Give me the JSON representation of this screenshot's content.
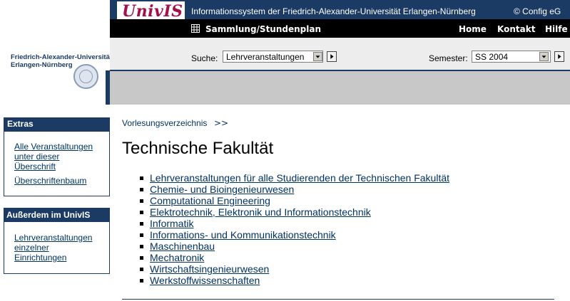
{
  "header": {
    "logo_text": "UnivIS",
    "title": "Informationssystem der Friedrich-Alexander-Universität Erlangen-Nürnberg",
    "copyright": "© Config eG",
    "university_line1": "Friedrich-Alexander-Universität",
    "university_line2": "Erlangen-Nürnberg"
  },
  "nav": {
    "collection": "Sammlung/Stundenplan",
    "home": "Home",
    "contact": "Kontakt",
    "help": "Hilfe"
  },
  "search": {
    "label": "Suche:",
    "selected": "Lehrveranstaltungen",
    "semester_label": "Semester:",
    "semester_selected": "SS 2004"
  },
  "sidebar": {
    "extras": {
      "title": "Extras",
      "links": [
        "Alle Veranstaltungen",
        "unter dieser",
        "Überschrift",
        "Überschriftenbaum"
      ]
    },
    "ausserdem": {
      "title": "Außerdem im UnivIS",
      "links": [
        "Lehrveranstaltungen",
        "einzelner",
        "Einrichtungen"
      ]
    }
  },
  "main": {
    "breadcrumb": "Vorlesungsverzeichnis",
    "breadcrumb_sep": ">>",
    "title": "Technische Fakultät",
    "items": [
      "Lehrveranstaltungen für alle Studierenden der Technischen Fakultät",
      "Chemie- und Bioingenieurwesen",
      "Computational Engineering",
      "Elektrotechnik, Elektronik und Informationstechnik",
      "Informatik",
      "Informations- und Kommunikationstechnik",
      "Maschinenbau",
      "Mechatronik",
      "Wirtschaftsingenieurwesen",
      "Werkstoffwissenschaften"
    ]
  },
  "colors": {
    "navy": "#1b3a64",
    "logo": "#a3114b",
    "link": "#003366"
  },
  "icons": {
    "collection": "grid-icon",
    "dropdown": "triangle-down-icon",
    "go": "triangle-right-icon"
  }
}
